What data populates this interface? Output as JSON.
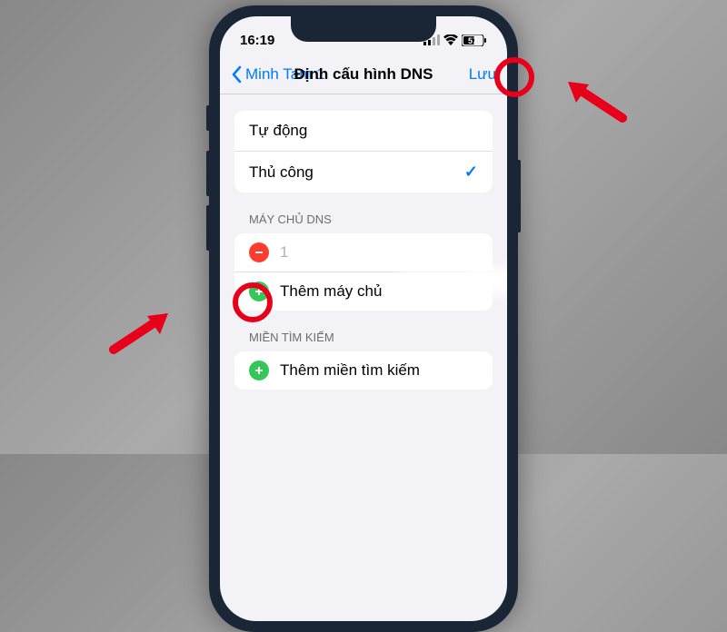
{
  "status": {
    "time": "16:19",
    "battery": "57"
  },
  "nav": {
    "back_label": "Minh Tam 1",
    "title": "Định cấu hình DNS",
    "save": "Lưu"
  },
  "mode": {
    "auto": "Tự động",
    "manual": "Thủ công"
  },
  "dns": {
    "header": "MÁY CHỦ DNS",
    "entry0": "1",
    "add": "Thêm máy chủ"
  },
  "search": {
    "header": "MIỀN TÌM KIẾM",
    "add": "Thêm miền tìm kiếm"
  }
}
